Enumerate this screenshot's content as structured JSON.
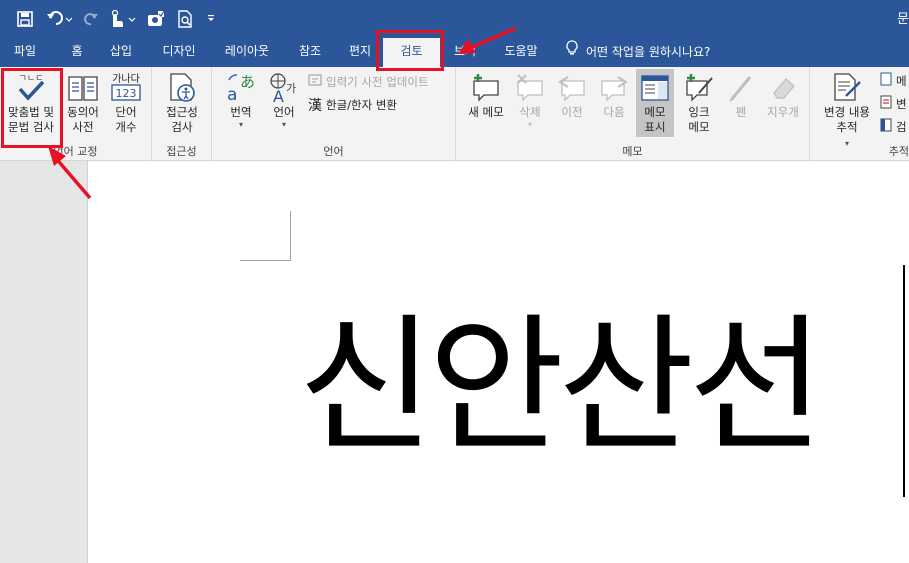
{
  "window": {
    "title_fragment": "문"
  },
  "qat": {
    "icons": [
      "save-icon",
      "undo-icon",
      "redo-icon",
      "touch-mode-icon",
      "spelling-icon",
      "print-preview-icon",
      "customize-icon"
    ]
  },
  "tabs": [
    {
      "id": "file",
      "label": "파일"
    },
    {
      "id": "home",
      "label": "홈"
    },
    {
      "id": "insert",
      "label": "삽입"
    },
    {
      "id": "design",
      "label": "디자인"
    },
    {
      "id": "layout",
      "label": "레이아웃"
    },
    {
      "id": "references",
      "label": "참조"
    },
    {
      "id": "mailings",
      "label": "편지"
    },
    {
      "id": "review",
      "label": "검토",
      "active": true
    },
    {
      "id": "view",
      "label": "보기"
    },
    {
      "id": "help",
      "label": "도움말"
    }
  ],
  "tell_me": {
    "label": "어떤 작업을 원하시나요?"
  },
  "ribbon": {
    "proofing": {
      "group_label": "언어 교정",
      "spelling": {
        "line1": "맞춤법 및",
        "line2": "문법 검사",
        "icon_text": "ㄱㄴㄷ"
      },
      "thesaurus": {
        "line1": "동의어",
        "line2": "사전"
      },
      "word_count": {
        "line1": "단어",
        "line2": "개수",
        "icon_text1": "가나다",
        "icon_text2": "123"
      }
    },
    "accessibility": {
      "group_label": "접근성",
      "check": {
        "line1": "접근성",
        "line2": "검사"
      }
    },
    "language": {
      "group_label": "언어",
      "translate": {
        "label": "번역",
        "icon_a": "a",
        "icon_b": "あ"
      },
      "language": {
        "label": "언어",
        "icon_a": "A",
        "icon_b": "가"
      },
      "ime_update": {
        "label": "입력기 사전 업데이트"
      },
      "hanja": {
        "label": "한글/한자 변환",
        "icon_text": "漢"
      }
    },
    "comments": {
      "group_label": "메모",
      "new": {
        "label": "새 메모"
      },
      "delete": {
        "label": "삭제"
      },
      "previous": {
        "label": "이전"
      },
      "next": {
        "label": "다음"
      },
      "show": {
        "line1": "메모",
        "line2": "표시"
      },
      "ink": {
        "line1": "잉크",
        "line2": "메모"
      },
      "pen": {
        "label": "펜"
      },
      "eraser": {
        "label": "지우개"
      }
    },
    "tracking": {
      "group_label": "추적",
      "track": {
        "line1": "변경 내용",
        "line2": "추적"
      },
      "side_labels": [
        "메",
        "변",
        "검"
      ]
    }
  },
  "document": {
    "text": "신안산선"
  },
  "colors": {
    "brand": "#2b579a",
    "highlight": "#e81123",
    "ribbon_bg": "#f3f3f3"
  }
}
